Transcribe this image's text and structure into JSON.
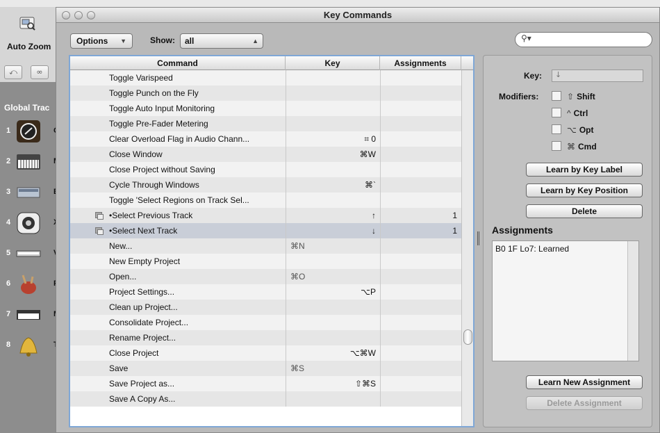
{
  "background_app": {
    "auto_zoom_label": "Auto Zoom",
    "global_tracks_label": "Global Trac",
    "tracks": [
      {
        "num": "1",
        "letter": "C"
      },
      {
        "num": "2",
        "letter": "M"
      },
      {
        "num": "3",
        "letter": "B"
      },
      {
        "num": "4",
        "letter": "X"
      },
      {
        "num": "5",
        "letter": "V"
      },
      {
        "num": "6",
        "letter": "F"
      },
      {
        "num": "7",
        "letter": "M"
      },
      {
        "num": "8",
        "letter": "T"
      }
    ]
  },
  "window": {
    "title": "Key Commands"
  },
  "toolbar": {
    "options_label": "Options",
    "show_label": "Show:",
    "show_value": "all",
    "search_placeholder": ""
  },
  "table": {
    "headers": {
      "command": "Command",
      "key": "Key",
      "assignments": "Assignments"
    },
    "rows": [
      {
        "command": "Toggle Varispeed",
        "key": "",
        "key_left": "",
        "assignments": ""
      },
      {
        "command": "Toggle Punch on the Fly",
        "key": "",
        "key_left": "",
        "assignments": ""
      },
      {
        "command": "Toggle Auto Input Monitoring",
        "key": "",
        "key_left": "",
        "assignments": ""
      },
      {
        "command": "Toggle Pre-Fader Metering",
        "key": "",
        "key_left": "",
        "assignments": ""
      },
      {
        "command": "Clear Overload Flag in Audio Chann...",
        "key": "⌗ 0",
        "key_left": "",
        "assignments": ""
      },
      {
        "command": "Close Window",
        "key": "⌘W",
        "key_left": "",
        "assignments": ""
      },
      {
        "command": "Close Project without Saving",
        "key": "",
        "key_left": "",
        "assignments": ""
      },
      {
        "command": "Cycle Through Windows",
        "key": "⌘`",
        "key_left": "",
        "assignments": ""
      },
      {
        "command": "Toggle 'Select Regions on Track Sel...",
        "key": "",
        "key_left": "",
        "assignments": ""
      },
      {
        "command": "•Select Previous Track",
        "key": "↑",
        "key_left": "",
        "assignments": "1",
        "icon": "copy-icon"
      },
      {
        "command": "•Select Next Track",
        "key": "↓",
        "key_left": "",
        "assignments": "1",
        "icon": "copy-icon",
        "selected": true
      },
      {
        "command": "New...",
        "key": "",
        "key_left": "⌘N",
        "assignments": ""
      },
      {
        "command": "New Empty Project",
        "key": "",
        "key_left": "",
        "assignments": ""
      },
      {
        "command": "Open...",
        "key": "",
        "key_left": "⌘O",
        "assignments": ""
      },
      {
        "command": "Project Settings...",
        "key": "⌥P",
        "key_left": "",
        "assignments": ""
      },
      {
        "command": "Clean up Project...",
        "key": "",
        "key_left": "",
        "assignments": ""
      },
      {
        "command": "Consolidate Project...",
        "key": "",
        "key_left": "",
        "assignments": ""
      },
      {
        "command": "Rename Project...",
        "key": "",
        "key_left": "",
        "assignments": ""
      },
      {
        "command": "Close Project",
        "key": "⌥⌘W",
        "key_left": "",
        "assignments": ""
      },
      {
        "command": "Save",
        "key": "",
        "key_left": "⌘S",
        "assignments": ""
      },
      {
        "command": "Save Project as...",
        "key": "⇧⌘S",
        "key_left": "",
        "assignments": ""
      },
      {
        "command": "Save A Copy As...",
        "key": "",
        "key_left": "",
        "assignments": ""
      }
    ]
  },
  "right_panel": {
    "key_label": "Key:",
    "key_value": "↓",
    "modifiers_label": "Modifiers:",
    "modifiers": [
      {
        "symbol": "⇧",
        "label": "Shift"
      },
      {
        "symbol": "^",
        "label": "Ctrl"
      },
      {
        "symbol": "⌥",
        "label": "Opt"
      },
      {
        "symbol": "⌘",
        "label": "Cmd"
      }
    ],
    "learn_by_key_label": "Learn by Key Label",
    "learn_by_key_position": "Learn by Key Position",
    "delete_label": "Delete",
    "assignments_header": "Assignments",
    "assignments": [
      "B0 1F Lo7: Learned"
    ],
    "learn_new_assignment": "Learn New Assignment",
    "delete_assignment": "Delete Assignment"
  },
  "colors": {
    "selection": "#c9ced8",
    "focus_ring": "#7fa7d6"
  }
}
